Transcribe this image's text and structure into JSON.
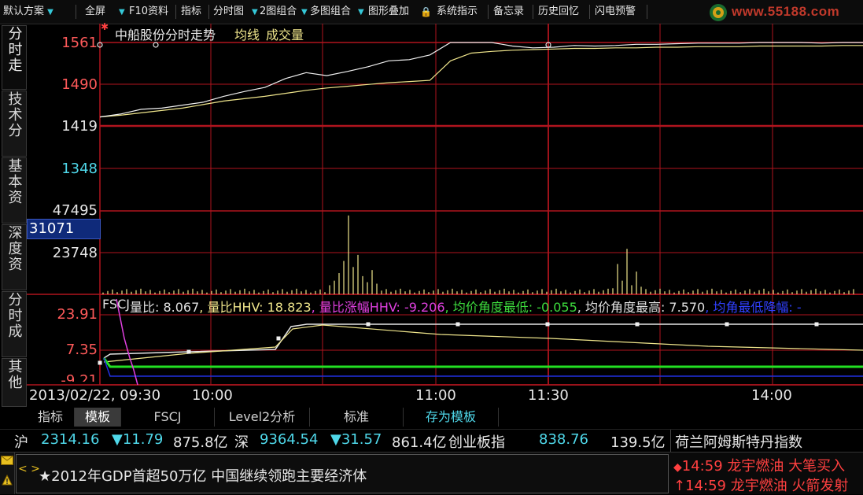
{
  "toolbar": {
    "items": [
      "默认方案",
      "全屏",
      "F10资料",
      "指标",
      "分时图",
      "2图组合",
      "多图组合",
      "图形叠加",
      "系统指示",
      "备忘录",
      "历史回忆",
      "闪电预警"
    ],
    "logo_text": "www.55188.com"
  },
  "side_tabs": [
    {
      "label": "分时走"
    },
    {
      "label": "技术分"
    },
    {
      "label": "基本资"
    },
    {
      "label": "深度资"
    },
    {
      "label": "分时成"
    },
    {
      "label": "其他"
    }
  ],
  "chart_data": [
    {
      "type": "line",
      "title": "中船股份分时走势",
      "legend": [
        "均线",
        "成交量"
      ],
      "y_ticks": [
        "1561",
        "1490",
        "1419",
        "1348"
      ],
      "x_ticks": [
        "2013/02/22, 09:30",
        "10:00",
        "11:00",
        "11:30",
        "14:00"
      ],
      "series": [
        {
          "name": "price",
          "values": [
            1435,
            1440,
            1448,
            1450,
            1455,
            1460,
            1470,
            1478,
            1485,
            1500,
            1510,
            1505,
            1512,
            1520,
            1530,
            1532,
            1540,
            1561,
            1561,
            1561,
            1555,
            1552,
            1553,
            1556,
            1555,
            1556,
            1558,
            1558,
            1559,
            1560,
            1560,
            1560,
            1561,
            1561,
            1561,
            1560,
            1561,
            1561
          ]
        },
        {
          "name": "均线",
          "values": [
            1435,
            1438,
            1442,
            1446,
            1450,
            1456,
            1462,
            1466,
            1470,
            1475,
            1480,
            1484,
            1487,
            1490,
            1493,
            1495,
            1497,
            1530,
            1543,
            1546,
            1548,
            1549,
            1550,
            1551,
            1551,
            1552,
            1552,
            1553,
            1553,
            1554,
            1554,
            1554,
            1555,
            1555,
            1555,
            1555,
            1556,
            1556
          ]
        }
      ]
    },
    {
      "type": "bar",
      "title": "成交量",
      "y_ticks": [
        "47495",
        "23748"
      ],
      "cursor_value": "31071",
      "ylim": [
        0,
        55000
      ]
    },
    {
      "type": "line",
      "title": "FSCJ",
      "y_ticks": [
        "23.91",
        "7.35",
        "-9.21"
      ],
      "ylim": [
        -9.21,
        23.91
      ]
    }
  ],
  "indicator_line": [
    {
      "text": "FSCJ",
      "color": "#e0e0e0"
    },
    {
      "text": " 量比: 8.067",
      "color": "#e0e0e0"
    },
    {
      "text": ", 量比HHV: 18.823",
      "color": "#f0e68c"
    },
    {
      "text": ", 量比涨幅HHV: -9.206",
      "color": "#e040e0"
    },
    {
      "text": ", 均价角度最低: -0.055",
      "color": "#3ddc3d"
    },
    {
      "text": ", 均价角度最高: 7.570",
      "color": "#e0e0e0"
    },
    {
      "text": ", 均角最低降幅: -",
      "color": "#3040ff"
    }
  ],
  "bottom_tabs": [
    "指标",
    "模板",
    "FSCJ",
    "Level2分析",
    "标准",
    "存为模板"
  ],
  "quotes": {
    "sh_label": "沪",
    "sh_value": "2314.16",
    "sh_change": "▼11.79",
    "sh_amount": "875.8亿",
    "sz_label": "深",
    "sz_value": "9364.54",
    "sz_change": "▼31.57",
    "sz_amount": "861.4亿",
    "cy_label": "创业板指",
    "cy_value": "838.76",
    "cy_amount": "139.5亿",
    "ticker_name": "荷兰阿姆斯特丹指数"
  },
  "news": {
    "headline": "★2012年GDP首超50万亿 中国继续领跑主要经济体",
    "alerts": [
      {
        "prefix": "◆",
        "time": "14:59",
        "stock": "龙宇燃油",
        "event": "大笔买入"
      },
      {
        "prefix": "↑",
        "time": "14:59",
        "stock": "龙宇燃油",
        "event": "火箭发射"
      }
    ]
  },
  "colors": {
    "grid": "#b0141e",
    "price": "#f0f0f0",
    "avg": "#f0e68c",
    "red_label": "#ff5a5a",
    "cyan_label": "#4fd8ea"
  }
}
